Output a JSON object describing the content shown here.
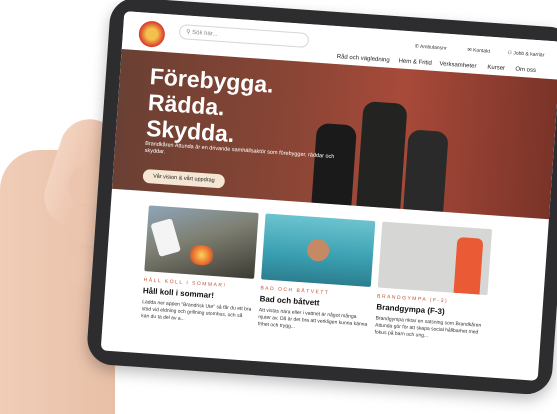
{
  "header": {
    "search_placeholder": "Sök här...",
    "utility_links": [
      "Ambulansnr",
      "Kontakt",
      "Jobb & karriär"
    ],
    "nav": [
      "Råd och vägledning",
      "Hem & Fritid",
      "Verksamheter",
      "Kurser",
      "Om oss"
    ]
  },
  "hero": {
    "title_lines": [
      "Förebygga.",
      "Rädda.",
      "Skydda."
    ],
    "text": "Brandkåren Attunda är en drivande samhällsaktör som förebygger, räddar och skyddar.",
    "button": "Vår vision & vårt uppdrag"
  },
  "cards": [
    {
      "kicker": "HÅLL KOLL I SOMMAR!",
      "title": "Håll koll i sommar!",
      "text": "Ladda ner appen \"Brandrisk Ute\" så får du ett bra stöd vid eldning och grillning utomhus, och så kan du ta del av a..."
    },
    {
      "kicker": "BAD OCH BÅTVETT",
      "title": "Bad och båtvett",
      "text": "Att vistas nära eller i vattnet är något många njuter av. Då är det bra att verkligen kunna känna frihet och trygg..."
    },
    {
      "kicker": "BRANDGYMPA (F-3)",
      "title": "Brandgympa (F-3)",
      "text": "Brandgympa riktar en satsning som Brandkåren Attunda gör för att skapa social hållbarhet med fokus på barn och ung..."
    }
  ],
  "colors": {
    "accent": "#c4512e",
    "hero_button": "#f5e6d3",
    "tablet_frame": "#2d2d2f"
  }
}
